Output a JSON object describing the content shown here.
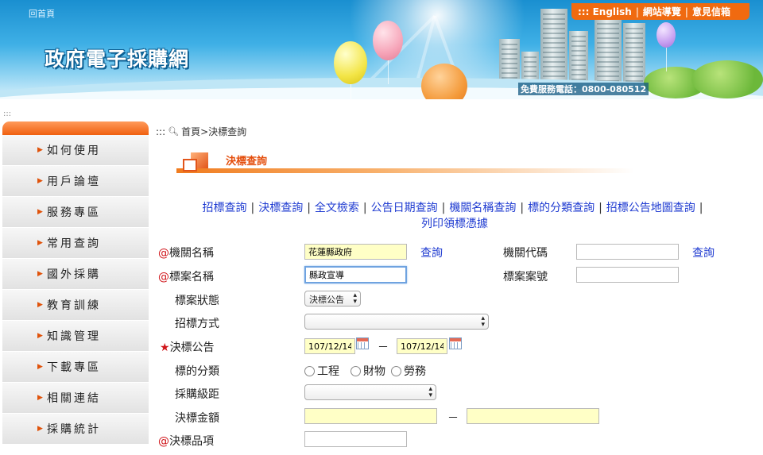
{
  "banner": {
    "home_link": "回首頁",
    "site_title": "政府電子採購網",
    "top_links": [
      "::: English",
      "網站導覽",
      "意見信箱"
    ],
    "phone": "免費服務電話：0800-080512"
  },
  "sidebar": {
    "dots": ":::",
    "items": [
      {
        "label": "如何使用"
      },
      {
        "label": "用戶論壇"
      },
      {
        "label": "服務專區"
      },
      {
        "label": "常用查詢"
      },
      {
        "label": "國外採購"
      },
      {
        "label": "教育訓練"
      },
      {
        "label": "知識管理"
      },
      {
        "label": "下載專區"
      },
      {
        "label": "相關連結"
      },
      {
        "label": "採購統計"
      }
    ]
  },
  "breadcrumb": {
    "prefix": ":::",
    "text": "首頁>決標查詢"
  },
  "page_title": "決標查詢",
  "nav_links": [
    "招標查詢",
    "決標查詢",
    "全文檢索",
    "公告日期查詢",
    "機關名稱查詢",
    "標的分類查詢",
    "招標公告地圖查詢",
    "列印領標憑據"
  ],
  "nav_sep": "|",
  "form": {
    "agency_name": {
      "at": "@",
      "label": "機關名稱",
      "value": "花蓮縣政府",
      "query": "查詢"
    },
    "agency_code": {
      "label": "機關代碼",
      "value": "",
      "query": "查詢"
    },
    "case_name": {
      "at": "@",
      "label": "標案名稱",
      "value": "縣政宣導"
    },
    "case_no": {
      "label": "標案案號",
      "value": ""
    },
    "case_status": {
      "label": "標案狀態",
      "selected": "決標公告"
    },
    "tender_method": {
      "label": "招標方式",
      "selected": ""
    },
    "award_notice": {
      "star": "★",
      "label": "決標公告",
      "from": "107/12/14",
      "to": "107/12/14",
      "dash": "－"
    },
    "category": {
      "label": "標的分類",
      "options": [
        "工程",
        "財物",
        "勞務"
      ]
    },
    "procurement_level": {
      "label": "採購級距",
      "selected": ""
    },
    "award_amount": {
      "label": "決標金額",
      "from": "",
      "to": "",
      "dash": "－"
    },
    "award_item": {
      "at": "@",
      "label": "決標品項",
      "value": ""
    }
  },
  "colors": {
    "accent_orange": "#f06a10",
    "link_blue": "#1f3bd1",
    "required_red": "#d0161b",
    "input_yellow": "#ffffc6"
  }
}
